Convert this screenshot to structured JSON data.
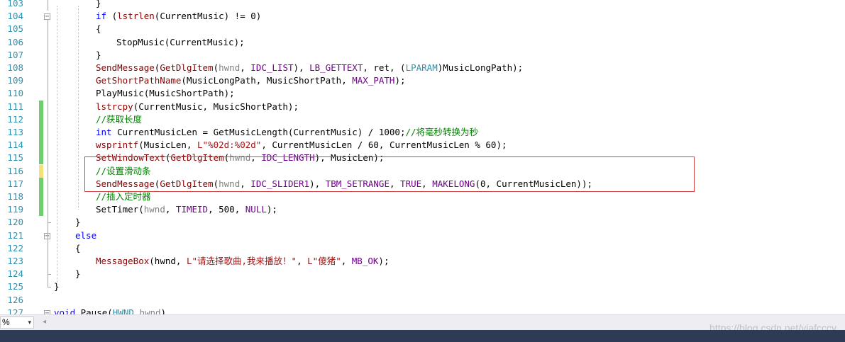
{
  "editor": {
    "gutter_lines": [
      "103",
      "104",
      "105",
      "106",
      "107",
      "108",
      "109",
      "110",
      "111",
      "112",
      "113",
      "114",
      "115",
      "116",
      "117",
      "118",
      "119",
      "120",
      "121",
      "122",
      "123",
      "124",
      "125",
      "126",
      "127"
    ],
    "change_bars": [
      {
        "line": "111",
        "color": "#6fcf6f"
      },
      {
        "line": "112",
        "color": "#6fcf6f"
      },
      {
        "line": "113",
        "color": "#6fcf6f"
      },
      {
        "line": "114",
        "color": "#6fcf6f"
      },
      {
        "line": "115",
        "color": "#6fcf6f"
      },
      {
        "line": "116",
        "color": "#f4e27a"
      },
      {
        "line": "117",
        "color": "#6fcf6f"
      },
      {
        "line": "118",
        "color": "#6fcf6f"
      },
      {
        "line": "119",
        "color": "#6fcf6f"
      }
    ],
    "lines": [
      [
        {
          "t": "}",
          "c": ""
        }
      ],
      [
        {
          "t": "if ",
          "c": "kw"
        },
        {
          "t": "(",
          "c": ""
        },
        {
          "t": "lstrlen",
          "c": "fn"
        },
        {
          "t": "(CurrentMusic) != 0)",
          "c": ""
        }
      ],
      [
        {
          "t": "{",
          "c": ""
        }
      ],
      [
        {
          "t": "StopMusic",
          "c": ""
        },
        {
          "t": "(CurrentMusic);",
          "c": ""
        }
      ],
      [
        {
          "t": "}",
          "c": ""
        }
      ],
      [
        {
          "t": "SendMessage",
          "c": "fn"
        },
        {
          "t": "(",
          "c": ""
        },
        {
          "t": "GetDlgItem",
          "c": "fn"
        },
        {
          "t": "(",
          "c": ""
        },
        {
          "t": "hwnd",
          "c": "par"
        },
        {
          "t": ", ",
          "c": ""
        },
        {
          "t": "IDC_LIST",
          "c": "mac"
        },
        {
          "t": "), ",
          "c": ""
        },
        {
          "t": "LB_GETTEXT",
          "c": "mac"
        },
        {
          "t": ", ret, (",
          "c": ""
        },
        {
          "t": "LPARAM",
          "c": "type"
        },
        {
          "t": ")MusicLongPath);",
          "c": ""
        }
      ],
      [
        {
          "t": "GetShortPathName",
          "c": "fn"
        },
        {
          "t": "(MusicLongPath, MusicShortPath, ",
          "c": ""
        },
        {
          "t": "MAX_PATH",
          "c": "mac"
        },
        {
          "t": ");",
          "c": ""
        }
      ],
      [
        {
          "t": "PlayMusic",
          "c": ""
        },
        {
          "t": "(MusicShortPath);",
          "c": ""
        }
      ],
      [
        {
          "t": "lstrcpy",
          "c": "fn"
        },
        {
          "t": "(CurrentMusic, MusicShortPath);",
          "c": ""
        }
      ],
      [
        {
          "t": "//获取长度",
          "c": "cmt"
        }
      ],
      [
        {
          "t": "int",
          "c": "kw"
        },
        {
          "t": " CurrentMusicLen = GetMusicLength(CurrentMusic) / 1000;",
          "c": ""
        },
        {
          "t": "//将毫秒转换为秒",
          "c": "cmt"
        }
      ],
      [
        {
          "t": "wsprintf",
          "c": "fn"
        },
        {
          "t": "(MusicLen, ",
          "c": ""
        },
        {
          "t": "L\"%02d:%02d\"",
          "c": "str"
        },
        {
          "t": ", CurrentMusicLen / 60, CurrentMusicLen % 60);",
          "c": ""
        }
      ],
      [
        {
          "t": "SetWindowText",
          "c": "fn"
        },
        {
          "t": "(",
          "c": ""
        },
        {
          "t": "GetDlgItem",
          "c": "fn"
        },
        {
          "t": "(",
          "c": ""
        },
        {
          "t": "hwnd",
          "c": "par"
        },
        {
          "t": ", ",
          "c": ""
        },
        {
          "t": "IDC_LENGTH",
          "c": "mac"
        },
        {
          "t": "), MusicLen);",
          "c": ""
        }
      ],
      [
        {
          "t": "//设置滑动条",
          "c": "cmt"
        }
      ],
      [
        {
          "t": "SendMessage",
          "c": "fn"
        },
        {
          "t": "(",
          "c": ""
        },
        {
          "t": "GetDlgItem",
          "c": "fn"
        },
        {
          "t": "(",
          "c": ""
        },
        {
          "t": "hwnd",
          "c": "par"
        },
        {
          "t": ", ",
          "c": ""
        },
        {
          "t": "IDC_SLIDER1",
          "c": "mac"
        },
        {
          "t": "), ",
          "c": ""
        },
        {
          "t": "TBM_SETRANGE",
          "c": "mac"
        },
        {
          "t": ", ",
          "c": ""
        },
        {
          "t": "TRUE",
          "c": "mac"
        },
        {
          "t": ", ",
          "c": ""
        },
        {
          "t": "MAKELONG",
          "c": "mac"
        },
        {
          "t": "(0, CurrentMusicLen));",
          "c": ""
        }
      ],
      [
        {
          "t": "//插入定时器",
          "c": "cmt"
        }
      ],
      [
        {
          "t": "SetTimer",
          "c": ""
        },
        {
          "t": "(",
          "c": ""
        },
        {
          "t": "hwnd",
          "c": "par"
        },
        {
          "t": ", ",
          "c": ""
        },
        {
          "t": "TIMEID",
          "c": "mac"
        },
        {
          "t": ", 500, ",
          "c": ""
        },
        {
          "t": "NULL",
          "c": "mac"
        },
        {
          "t": ");",
          "c": ""
        }
      ],
      [
        {
          "t": "}",
          "c": ""
        }
      ],
      [
        {
          "t": "else",
          "c": "kw"
        }
      ],
      [
        {
          "t": "{",
          "c": ""
        }
      ],
      [
        {
          "t": "MessageBox",
          "c": "fn"
        },
        {
          "t": "(",
          "c": ""
        },
        {
          "t": "hwnd",
          "c": ""
        },
        {
          "t": ", ",
          "c": ""
        },
        {
          "t": "L\"请选择歌曲,我来播放！\"",
          "c": "str"
        },
        {
          "t": ", ",
          "c": ""
        },
        {
          "t": "L\"傻猪\"",
          "c": "str"
        },
        {
          "t": ", ",
          "c": ""
        },
        {
          "t": "MB_OK",
          "c": "mac"
        },
        {
          "t": ");",
          "c": ""
        }
      ],
      [
        {
          "t": "}",
          "c": ""
        }
      ],
      [
        {
          "t": "}",
          "c": ""
        }
      ],
      [],
      [
        {
          "t": "void",
          "c": "kw"
        },
        {
          "t": " Pause(",
          "c": ""
        },
        {
          "t": "HWND",
          "c": "type"
        },
        {
          "t": " ",
          "c": ""
        },
        {
          "t": "hwnd",
          "c": "par"
        },
        {
          "t": ")",
          "c": ""
        }
      ]
    ]
  },
  "statusbar": {
    "zoom_value": "%",
    "zoom_arrow": "▾",
    "scroll_left": "◂"
  },
  "watermark": "https://blog.csdn.net/viafcccy"
}
